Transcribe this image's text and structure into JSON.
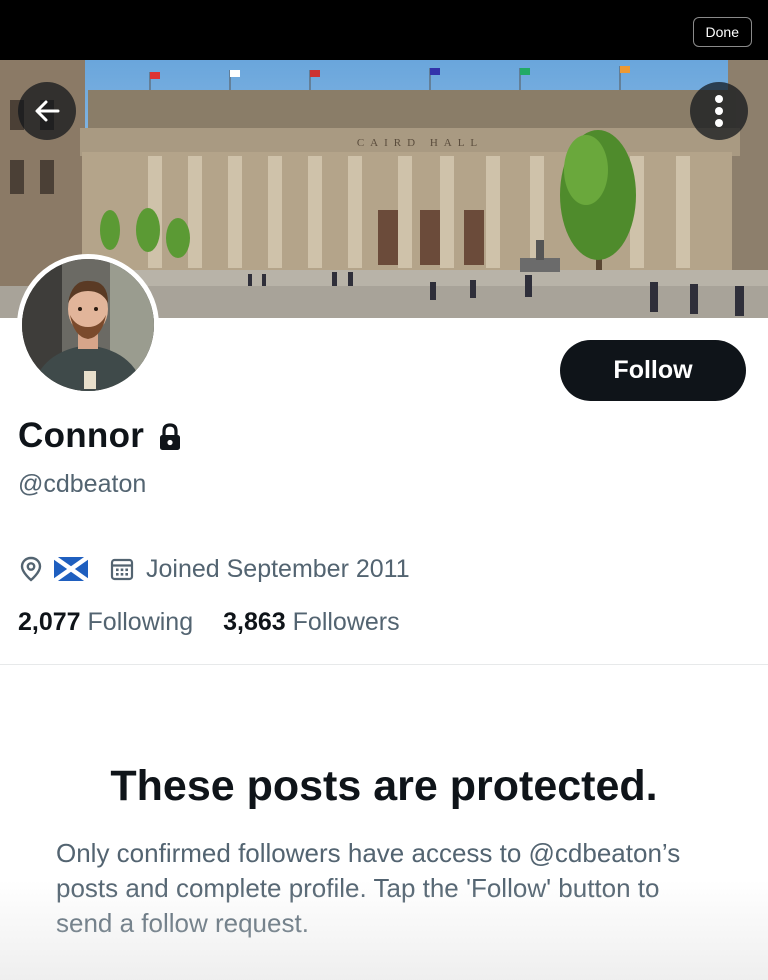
{
  "topbar": {
    "done_label": "Done"
  },
  "banner": {
    "building_inscription": "CAIRD HALL"
  },
  "profile": {
    "follow_label": "Follow",
    "name": "Connor",
    "handle": "@cdbeaton",
    "location_flag": "scotland-flag",
    "joined": "Joined September 2011",
    "following_count": "2,077",
    "following_label": "Following",
    "followers_count": "3,863",
    "followers_label": "Followers"
  },
  "protected": {
    "title": "These posts are protected.",
    "description": "Only confirmed followers have access to @cdbeaton’s posts and complete profile. Tap the 'Follow' button to send a follow request."
  },
  "icons": {
    "back": "arrow-left-icon",
    "more": "more-vertical-icon",
    "lock": "lock-icon",
    "location": "location-pin-icon",
    "calendar": "calendar-icon"
  },
  "colors": {
    "primary_text": "#0f1419",
    "secondary_text": "#536471",
    "follow_button_bg": "#0f1419",
    "divider": "#e7e9ea"
  }
}
